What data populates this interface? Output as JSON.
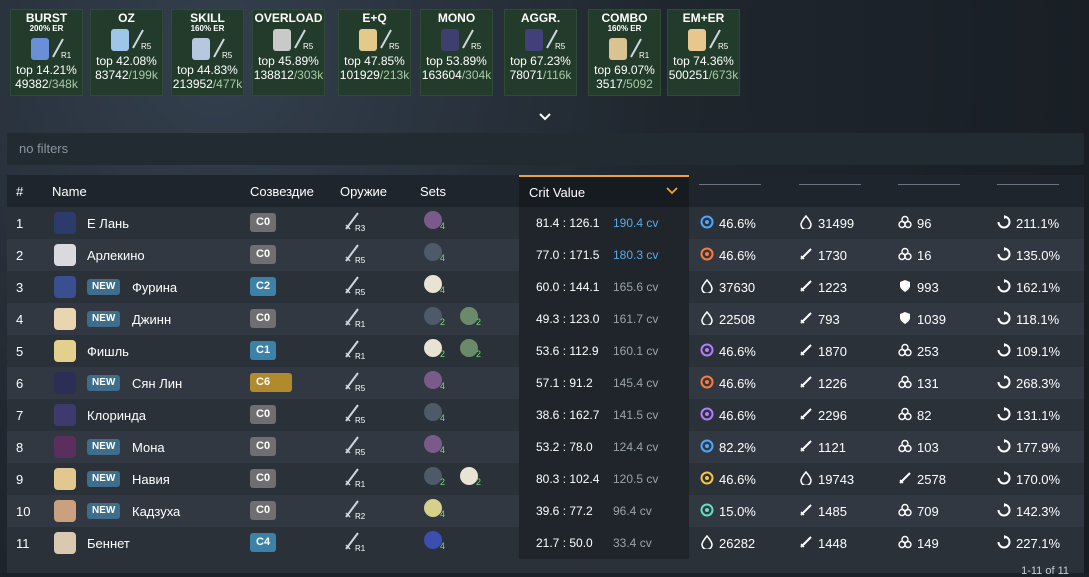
{
  "builds": [
    {
      "title": "BURST",
      "sub": "200% ER",
      "rank": "R1",
      "top": "top 14.21%",
      "num": "49382",
      "den": "/348k",
      "color": "#6b8fd6"
    },
    {
      "title": "OZ",
      "sub": "",
      "rank": "R5",
      "top": "top 42.08%",
      "num": "83742",
      "den": "/199k",
      "color": "#9fc5e8"
    },
    {
      "title": "SKILL",
      "sub": "160% ER",
      "rank": "R5",
      "top": "top 44.83%",
      "num": "213952",
      "den": "/477k",
      "color": "#b6c8df"
    },
    {
      "title": "OVERLOAD",
      "sub": "",
      "rank": "R5",
      "top": "top 45.89%",
      "num": "138812",
      "den": "/303k",
      "color": "#c9c9c9"
    },
    {
      "title": "E+Q",
      "sub": "",
      "rank": "R5",
      "top": "top 47.85%",
      "num": "101929",
      "den": "/213k",
      "color": "#e3c98a"
    },
    {
      "title": "MONO",
      "sub": "",
      "rank": "R5",
      "top": "top 53.89%",
      "num": "163604",
      "den": "/304k",
      "color": "#3d3f6e"
    },
    {
      "title": "AGGR.",
      "sub": "",
      "rank": "R5",
      "top": "top 67.23%",
      "num": "78071",
      "den": "/116k",
      "color": "#41407a"
    },
    {
      "title": "COMBO",
      "sub": "160% ER",
      "rank": "R1",
      "top": "top 69.07%",
      "num": "3517",
      "den": "/5092",
      "color": "#d8c391"
    },
    {
      "title": "EM+ER",
      "sub": "",
      "rank": "R5",
      "top": "top 74.36%",
      "num": "500251",
      "den": "/673k",
      "color": "#e7c78e"
    }
  ],
  "filter": {
    "text": "no filters"
  },
  "headers": {
    "idx": "#",
    "name": "Name",
    "cons": "Созвездие",
    "weapon": "Оружие",
    "sets": "Sets",
    "cv": "Crit Value"
  },
  "rows": [
    {
      "idx": "1",
      "name": "Е Лань",
      "new": false,
      "cons": "C0",
      "cc": "",
      "wr": "R3",
      "sets": [
        {
          "n": "4",
          "c": "#7a5a8a"
        }
      ],
      "crit": "81.4 : 126.1",
      "cv": "190.4 cv",
      "cvc": "#5aa9e6",
      "s1i": "hydro",
      "s1": "46.6%",
      "s2i": "drop",
      "s2": "31499",
      "s3i": "em",
      "s3": "96",
      "s4": "211.1%",
      "av": "#2c3b6b"
    },
    {
      "idx": "2",
      "name": "Арлекино",
      "new": false,
      "cons": "C0",
      "cc": "",
      "wr": "R5",
      "sets": [
        {
          "n": "4",
          "c": "#4e5a6a"
        }
      ],
      "crit": "77.0 : 171.5",
      "cv": "180.3 cv",
      "cvc": "#5aa9e6",
      "s1i": "pyro",
      "s1": "46.6%",
      "s2i": "sword",
      "s2": "1730",
      "s3i": "em",
      "s3": "16",
      "s4": "135.0%",
      "av": "#d9d9df"
    },
    {
      "idx": "3",
      "name": "Фурина",
      "new": true,
      "cons": "C2",
      "cc": "c2",
      "wr": "R5",
      "sets": [
        {
          "n": "4",
          "c": "#e8e3d2"
        }
      ],
      "crit": "60.0 : 144.1",
      "cv": "165.6 cv",
      "cvc": "#9aa3ad",
      "s1i": "drop",
      "s1": "37630",
      "s2i": "sword",
      "s2": "1223",
      "s3i": "shield",
      "s3": "993",
      "s4": "162.1%",
      "av": "#3a4f8f"
    },
    {
      "idx": "4",
      "name": "Джинн",
      "new": true,
      "cons": "C0",
      "cc": "",
      "wr": "R1",
      "sets": [
        {
          "n": "2",
          "c": "#4e5a6a"
        },
        {
          "n": "2",
          "c": "#6b8a6a"
        }
      ],
      "crit": "49.3 : 123.0",
      "cv": "161.7 cv",
      "cvc": "#9aa3ad",
      "s1i": "drop",
      "s1": "22508",
      "s2i": "sword",
      "s2": "793",
      "s3i": "shield",
      "s3": "1039",
      "s4": "118.1%",
      "av": "#e7d6b0"
    },
    {
      "idx": "5",
      "name": "Фишль",
      "new": false,
      "cons": "C1",
      "cc": "c1",
      "wr": "R1",
      "sets": [
        {
          "n": "2",
          "c": "#e8e3d2"
        },
        {
          "n": "2",
          "c": "#6b8a6a"
        }
      ],
      "crit": "53.6 : 112.9",
      "cv": "160.1 cv",
      "cvc": "#9aa3ad",
      "s1i": "electro",
      "s1": "46.6%",
      "s2i": "sword",
      "s2": "1870",
      "s3i": "em",
      "s3": "253",
      "s4": "109.1%",
      "av": "#e3d08c"
    },
    {
      "idx": "6",
      "name": "Сян Лин",
      "new": true,
      "cons": "C6",
      "cc": "c6",
      "wr": "R5",
      "sets": [
        {
          "n": "4",
          "c": "#7a5a8a"
        }
      ],
      "crit": "57.1 : 91.2",
      "cv": "145.4 cv",
      "cvc": "#9aa3ad",
      "s1i": "pyro",
      "s1": "46.6%",
      "s2i": "sword",
      "s2": "1226",
      "s3i": "em",
      "s3": "131",
      "s4": "268.3%",
      "av": "#2b2f55"
    },
    {
      "idx": "7",
      "name": "Клоринда",
      "new": false,
      "cons": "C0",
      "cc": "",
      "wr": "R5",
      "sets": [
        {
          "n": "4",
          "c": "#4e5a6a"
        }
      ],
      "crit": "38.6 : 162.7",
      "cv": "141.5 cv",
      "cvc": "#9aa3ad",
      "s1i": "electro",
      "s1": "46.6%",
      "s2i": "sword",
      "s2": "2296",
      "s3i": "em",
      "s3": "82",
      "s4": "131.1%",
      "av": "#3f3a6e"
    },
    {
      "idx": "8",
      "name": "Мона",
      "new": true,
      "cons": "C0",
      "cc": "",
      "wr": "R5",
      "sets": [
        {
          "n": "4",
          "c": "#7a5a8a"
        }
      ],
      "crit": "53.2 : 78.0",
      "cv": "124.4 cv",
      "cvc": "#9aa3ad",
      "s1i": "hydro",
      "s1": "82.2%",
      "s2i": "sword",
      "s2": "1121",
      "s3i": "em",
      "s3": "103",
      "s4": "177.9%",
      "av": "#5a2f5e"
    },
    {
      "idx": "9",
      "name": "Навия",
      "new": true,
      "cons": "C0",
      "cc": "",
      "wr": "R1",
      "sets": [
        {
          "n": "2",
          "c": "#4e5a6a"
        },
        {
          "n": "2",
          "c": "#e8e3d2"
        }
      ],
      "crit": "80.3 : 102.4",
      "cv": "120.5 cv",
      "cvc": "#9aa3ad",
      "s1i": "geo",
      "s1": "46.6%",
      "s2i": "drop",
      "s2": "19743",
      "s3i": "sword",
      "s3": "2578",
      "s4": "170.0%",
      "av": "#e2c88f"
    },
    {
      "idx": "10",
      "name": "Кадзуха",
      "new": true,
      "cons": "C0",
      "cc": "",
      "wr": "R2",
      "sets": [
        {
          "n": "4",
          "c": "#d7d08a"
        }
      ],
      "crit": "39.6 : 77.2",
      "cv": "96.4 cv",
      "cvc": "#9aa3ad",
      "s1i": "anemo",
      "s1": "15.0%",
      "s2i": "sword",
      "s2": "1485",
      "s3i": "em",
      "s3": "709",
      "s4": "142.3%",
      "av": "#c9a17e"
    },
    {
      "idx": "11",
      "name": "Беннет",
      "new": false,
      "cons": "C4",
      "cc": "c4",
      "wr": "R1",
      "sets": [
        {
          "n": "4",
          "c": "#3b4fb0"
        }
      ],
      "crit": "21.7 : 50.0",
      "cv": "33.4 cv",
      "cvc": "#9aa3ad",
      "s1i": "drop",
      "s1": "26282",
      "s2i": "sword",
      "s2": "1448",
      "s3i": "em",
      "s3": "149",
      "s4": "227.1%",
      "av": "#d9c9b0"
    }
  ],
  "new_label": "NEW",
  "footer": "1-11 of 11",
  "colors": {
    "accent": "#f0a23a",
    "cv_blue": "#5aa9e6",
    "set_count": "#7fd47f",
    "card_bg": "#233b2b"
  }
}
